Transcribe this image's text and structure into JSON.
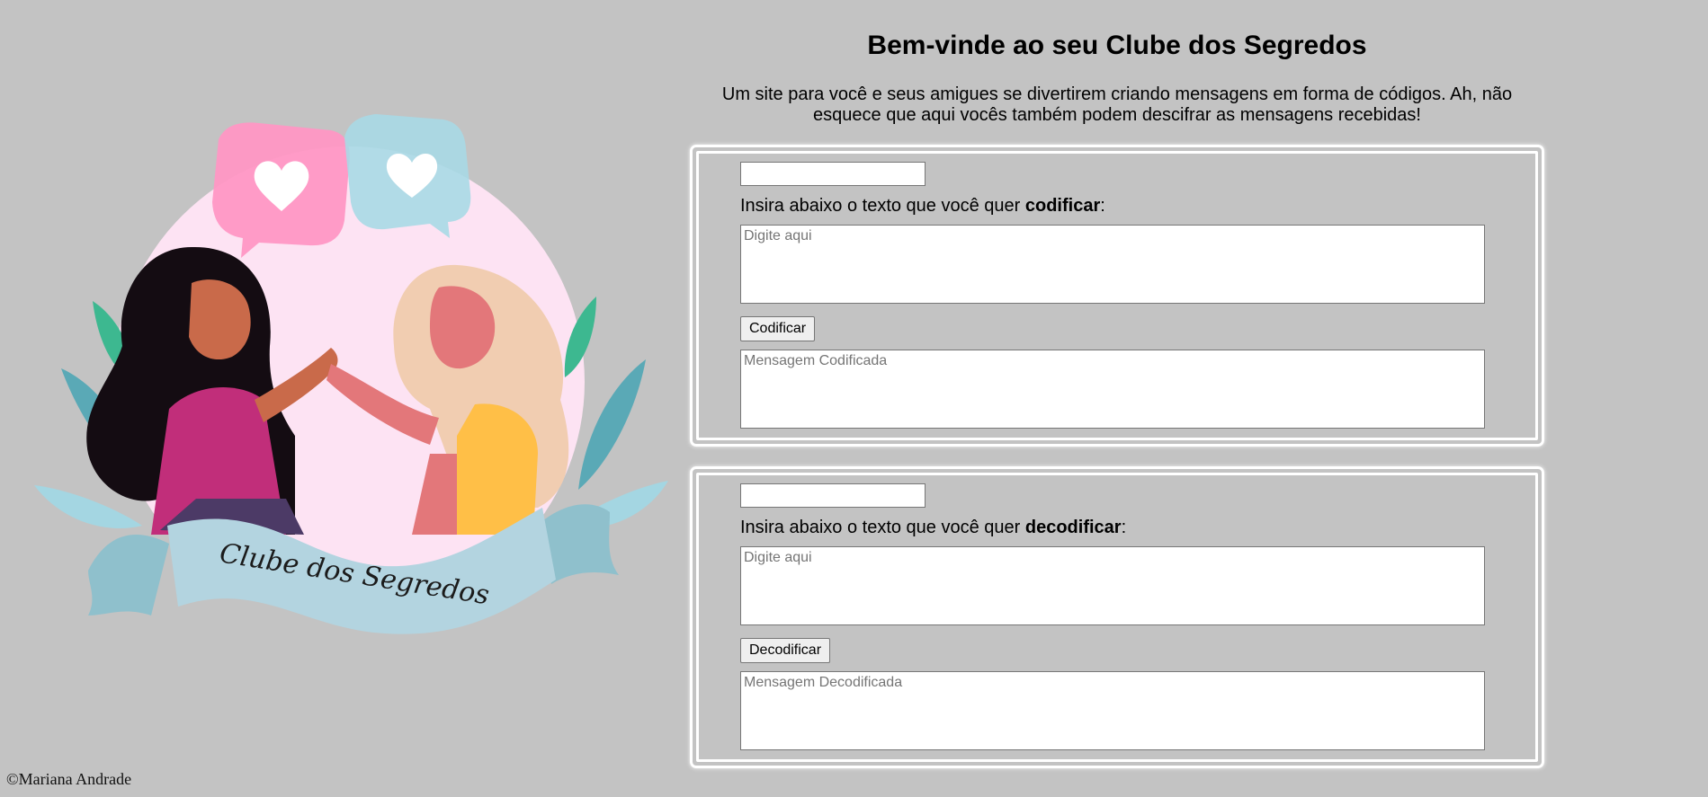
{
  "header": {
    "title": "Bem-vinde ao seu Clube dos Segredos",
    "subtitle_line1": "Um site para você e seus amigues se divertirem criando mensagens em forma de códigos. Ah, não",
    "subtitle_line2": "esquece que aqui vocês também podem descifrar as mensagens recebidas!"
  },
  "illustration": {
    "banner_text": "Clube dos Segredos",
    "icons": [
      "pink-heart-speech-bubble-icon",
      "blue-heart-speech-bubble-icon"
    ]
  },
  "encode_panel": {
    "key_value": "",
    "label_prefix": "Insira abaixo o texto que você quer ",
    "label_bold": "codificar",
    "label_suffix": ":",
    "input_placeholder": "Digite aqui",
    "button_label": "Codificar",
    "output_placeholder": "Mensagem Codificada"
  },
  "decode_panel": {
    "key_value": "",
    "label_prefix": "Insira abaixo o texto que você quer ",
    "label_bold": "decodificar",
    "label_suffix": ":",
    "input_placeholder": "Digite aqui",
    "button_label": "Decodificar",
    "output_placeholder": "Mensagem Decodificada"
  },
  "footer": {
    "text": "©Mariana Andrade"
  },
  "colors": {
    "background": "#c3c3c3",
    "panel_border": "#ffffff",
    "pink_bubble": "#ff97c4",
    "blue_bubble": "#a9d9e6",
    "banner": "#b3d4e0",
    "backdrop_circle": "#fde3f3"
  }
}
